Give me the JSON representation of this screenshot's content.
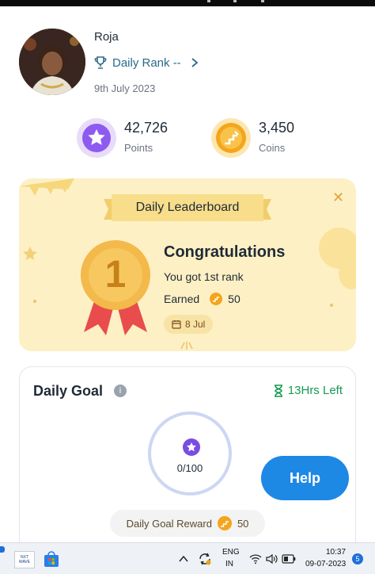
{
  "profile": {
    "name": "Roja",
    "rank_label": "Daily Rank --",
    "date": "9th July 2023"
  },
  "stats": {
    "points": {
      "value": "42,726",
      "label": "Points"
    },
    "coins": {
      "value": "3,450",
      "label": "Coins"
    }
  },
  "leaderboard": {
    "title": "Daily Leaderboard",
    "medal_number": "1",
    "heading": "Congratulations",
    "rank_text": "You got 1st rank",
    "earned_label": "Earned",
    "earned_value": "50",
    "date": "8 Jul"
  },
  "daily_goal": {
    "title": "Daily Goal",
    "time_left": "13Hrs Left",
    "progress": "0/100",
    "reward_label": "Daily Goal Reward",
    "reward_value": "50"
  },
  "help_label": "Help",
  "taskbar": {
    "app_label": "NXT WAVE",
    "lang_top": "ENG",
    "lang_bottom": "IN",
    "time": "10:37",
    "date": "09-07-2023",
    "notif_count": "5"
  },
  "colors": {
    "accent_blue": "#1e88e5",
    "rank_blue": "#2b6a8a",
    "timer_green": "#159a52",
    "points_purple": "#7b4ce0",
    "coins_orange": "#f4a51c"
  }
}
